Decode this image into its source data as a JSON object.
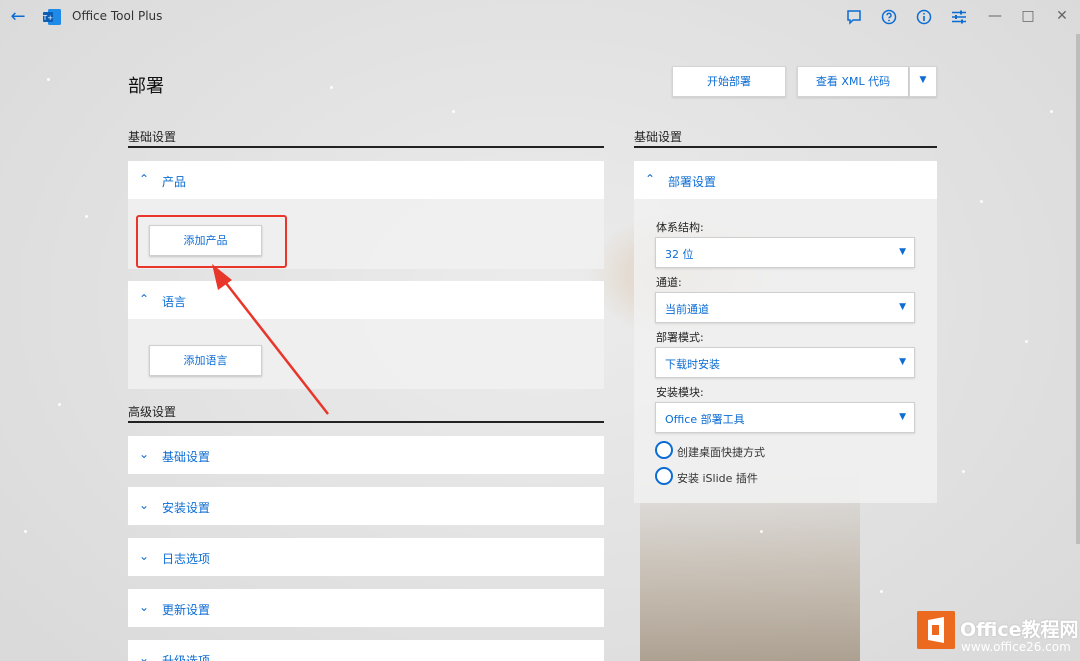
{
  "app": {
    "title": "Office Tool Plus",
    "logo_text": "T+"
  },
  "titlebar_icons": [
    "feedback-icon",
    "help-icon",
    "info-icon",
    "settings-sliders-icon",
    "minimize-icon",
    "maximize-icon",
    "close-icon"
  ],
  "page": {
    "title": "部署",
    "start_button": "开始部署",
    "xml_button": "查看 XML 代码"
  },
  "left": {
    "basic_label": "基础设置",
    "products_header": "产品",
    "add_product": "添加产品",
    "language_header": "语言",
    "add_language": "添加语言",
    "advanced_label": "高级设置",
    "advanced_items": [
      "基础设置",
      "安装设置",
      "日志选项",
      "更新设置",
      "升级选项"
    ]
  },
  "right": {
    "basic_label": "基础设置",
    "deploy_header": "部署设置",
    "arch_label": "体系结构:",
    "arch_value": "32 位",
    "channel_label": "通道:",
    "channel_value": "当前通道",
    "mode_label": "部署模式:",
    "mode_value": "下载时安装",
    "module_label": "安装模块:",
    "module_value": "Office 部署工具",
    "shortcut_label": "创建桌面快捷方式",
    "islide_label": "安装 iSlide 插件"
  },
  "watermark": {
    "brand": "Office教程网",
    "url": "www.office26.com"
  },
  "colors": {
    "accent": "#0b6cd4",
    "highlight": "#e8362b",
    "watermark_orange": "#ec6a1f"
  }
}
